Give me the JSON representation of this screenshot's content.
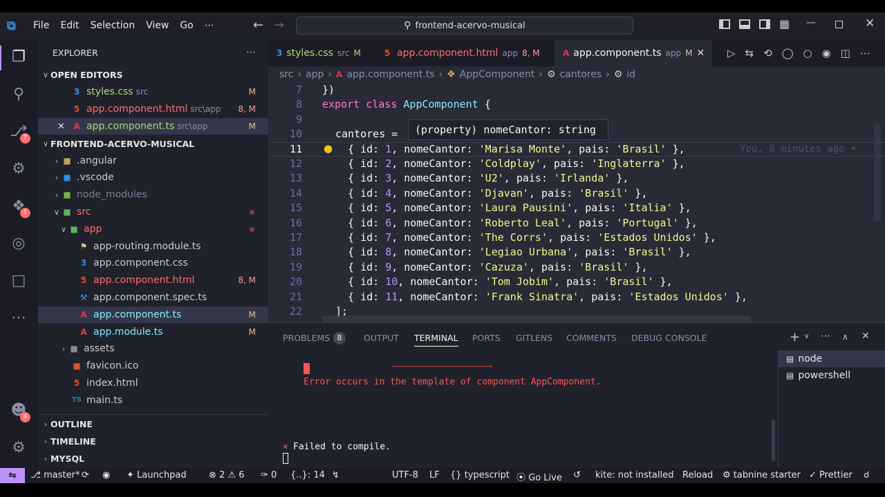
{
  "menu": [
    "File",
    "Edit",
    "Selection",
    "View",
    "Go",
    "⋯"
  ],
  "search": {
    "text": "frontend-acervo-musical"
  },
  "activity": {
    "source_control_badge": "7",
    "extensions_badge": "1",
    "accounts_badge": "4"
  },
  "sidebar": {
    "title": "EXPLORER",
    "open_editors_title": "OPEN EDITORS",
    "open_editors": [
      {
        "name": "styles.css",
        "desc": "src",
        "badge": "M",
        "icon": "css-icon"
      },
      {
        "name": "app.component.html",
        "desc": "src\\app",
        "badge": "8, M",
        "icon": "html-icon"
      },
      {
        "name": "app.component.ts",
        "desc": "src\\app",
        "badge": "M",
        "icon": "angular-icon"
      }
    ],
    "project_title": "FRONTEND-ACERVO-MUSICAL",
    "tree": [
      {
        "name": ".angular"
      },
      {
        "name": ".vscode"
      },
      {
        "name": "node_modules"
      },
      {
        "name": "src"
      },
      {
        "name": "app"
      },
      {
        "name": "app-routing.module.ts"
      },
      {
        "name": "app.component.css"
      },
      {
        "name": "app.component.html",
        "badge": "8, M"
      },
      {
        "name": "app.component.spec.ts"
      },
      {
        "name": "app.component.ts",
        "badge": "M"
      },
      {
        "name": "app.module.ts",
        "badge": "M"
      },
      {
        "name": "assets"
      },
      {
        "name": "favicon.ico"
      },
      {
        "name": "index.html"
      },
      {
        "name": "main.ts"
      }
    ],
    "sections": [
      "OUTLINE",
      "TIMELINE",
      "MYSQL"
    ]
  },
  "tabs": [
    {
      "name": "styles.css",
      "desc": "src",
      "badge": "M"
    },
    {
      "name": "app.component.html",
      "desc": "app",
      "badge": "8, M"
    },
    {
      "name": "app.component.ts",
      "desc": "app",
      "badge": "M"
    }
  ],
  "breadcrumb": [
    "src",
    "app",
    "app.component.ts",
    "AppComponent",
    "cantores",
    "id"
  ],
  "editor": {
    "line_numbers": [
      "7",
      "8",
      "9",
      "10",
      "11",
      "12",
      "13",
      "14",
      "15",
      "16",
      "17",
      "18",
      "19",
      "20",
      "21",
      "22"
    ],
    "hover": "(property) nomeCantor: string",
    "blame": "You, 8 minutes ago •",
    "class_decl": {
      "kw1": "export",
      "kw2": "class",
      "name": "AppComponent",
      "brace": "{"
    },
    "assign": "cantores = ",
    "rows": [
      {
        "id": "1",
        "nome": "'Marisa Monte'",
        "pais": "'Brasil'"
      },
      {
        "id": "2",
        "nome": "'Coldplay'",
        "pais": "'Inglaterra'"
      },
      {
        "id": "3",
        "nome": "'U2'",
        "pais": "'Irlanda'"
      },
      {
        "id": "4",
        "nome": "'Djavan'",
        "pais": "'Brasil'"
      },
      {
        "id": "5",
        "nome": "'Laura Pausini'",
        "pais": "'Italia'"
      },
      {
        "id": "6",
        "nome": "'Roberto Leal'",
        "pais": "'Portugal'"
      },
      {
        "id": "7",
        "nome": "'The Corrs'",
        "pais": "'Estados Unidos'"
      },
      {
        "id": "8",
        "nome": "'Legiao Urbana'",
        "pais": "'Brasil'"
      },
      {
        "id": "9",
        "nome": "'Cazuza'",
        "pais": "'Brasil'"
      },
      {
        "id": "10",
        "nome": "'Tom Jobim'",
        "pais": "'Brasil'"
      },
      {
        "id": "11",
        "nome": "'Frank Sinatra'",
        "pais": "'Estados Unidos'"
      }
    ],
    "close_line": "];"
  },
  "panel": {
    "tabs": [
      "PROBLEMS",
      "OUTPUT",
      "TERMINAL",
      "PORTS",
      "GITLENS",
      "COMMENTS",
      "DEBUG CONSOLE"
    ],
    "problems_count": "8",
    "squiggle": "~~~~~~~~~~~~~~~~~~~~~~",
    "error_line": "Error occurs in the template of component AppComponent.",
    "failed_prefix": "×",
    "failed_line": "Failed to compile.",
    "terminals": [
      "node",
      "powershell"
    ]
  },
  "status": {
    "branch": "master*",
    "launchpad": "Launchpad",
    "errors": "2",
    "warnings": "6",
    "ports": "0",
    "braces": "{..}: 14",
    "encoding": "UTF-8",
    "eol": "LF",
    "language": "typescript",
    "golive": "Go Live",
    "kite": "kite: not installed",
    "reload": "Reload",
    "tabnine": "tabnine starter",
    "prettier": "Prettier"
  }
}
